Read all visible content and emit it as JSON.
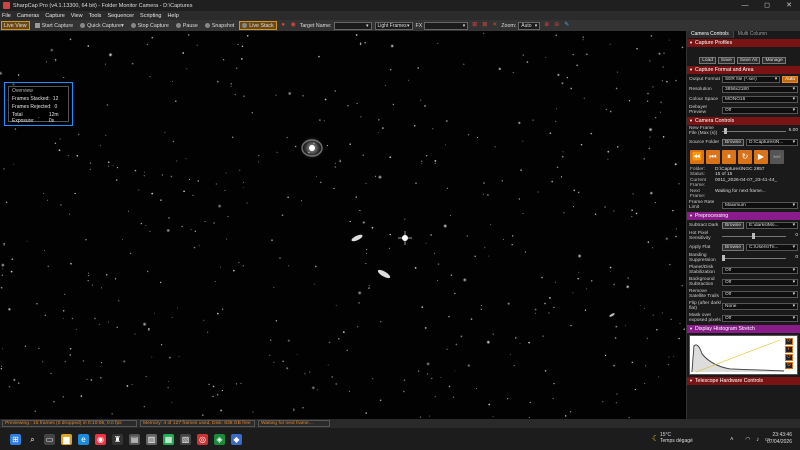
{
  "window": {
    "title": "SharpCap Pro (v4.1.13300, 64 bit) - Folder Monitor Camera - D:\\Captures",
    "minimize": "—",
    "maximize": "◻",
    "close": "✕"
  },
  "menu": [
    "File",
    "Cameras",
    "Capture",
    "View",
    "Tools",
    "Sequencer",
    "Scripting",
    "Help"
  ],
  "toolbar": {
    "live_view": "Live View",
    "start_capture": "Start Capture",
    "quick_capture": "Quick Capture",
    "stop_capture": "Stop Capture",
    "pause": "Pause",
    "snapshot": "Snapshot",
    "live_stack": "Live Stack",
    "target_name_label": "Target Name:",
    "frame_type": "Light Frames",
    "fx_label": "FX",
    "zoom_label": "Zoom:",
    "zoom_value": "Auto"
  },
  "overview": {
    "title": "Overview",
    "frames_stacked_label": "Frames Stacked:",
    "frames_stacked": "12",
    "frames_rejected_label": "Frames Rejected:",
    "frames_rejected": "0",
    "total_exposure_label": "Total Exposure:",
    "total_exposure": "12m 0s"
  },
  "panel": {
    "tab_camera": "Camera Controls",
    "tab_multi": "Multi Column",
    "capture_profiles": {
      "title": "Capture Profiles",
      "load": "Load",
      "save": "Save",
      "save_as": "Save As",
      "manage": "Manage"
    },
    "capture_format": {
      "title": "Capture Format and Area",
      "output_format_label": "Output Format",
      "output_format": "SER file (*.ser)",
      "auto": "Auto",
      "resolution_label": "Resolution",
      "resolution": "3856x2180",
      "colour_space_label": "Colour Space",
      "colour_space": "MONO16",
      "debayer_label": "Debayer Preview",
      "debayer": "Off"
    },
    "camera_controls": {
      "title": "Camera Controls",
      "new_frame_label": "New Frame File (Max (s))",
      "new_frame_value": "5.00",
      "source_folder_label": "Source Folder",
      "browse": "Browse",
      "source_folder": "D:\\Captures\\N...",
      "folder_label": "Folder:",
      "folder": "D:\\Captures\\NGC 2857",
      "status_label": "Status:",
      "status": "15 of 15",
      "current_frame_label": "Current Frame:",
      "current_frame": "0011_2026-04-07_23-41-44_",
      "next_frame_label": "Next Frame:",
      "next_frame": "Waiting for next frame...",
      "frame_rate_label": "Frame Rate Limit",
      "frame_rate": "Maximum"
    },
    "preprocessing": {
      "title": "Preprocessing",
      "subtract_dark_label": "Subtract Dark",
      "subtract_dark": "E:\\darks\\Mo...",
      "hot_pixel_label": "Hot Pixel Sensitivity",
      "hot_pixel": "0",
      "apply_flat_label": "Apply Flat",
      "apply_flat": "C:\\Users\\Tri...",
      "banding_label": "Banding Suppression",
      "banding": "0",
      "planet_label": "Planet/Disk Stabilization",
      "planet": "Off",
      "background_label": "Background Subtraction",
      "background": "Off",
      "remove_label": "Remove Satellite Trails",
      "remove": "Off",
      "flip_label": "Flip (after dark/ flat)",
      "flip": "None",
      "mask_label": "Mask over exposed pixels",
      "mask": "Off"
    },
    "histogram": {
      "title": "Display Histogram Stretch"
    },
    "telescope": {
      "title": "Telescope Hardware Controls"
    }
  },
  "status_bar": {
    "previewing": "Previewing : 15 frames (0 dropped) in 0:10:06, 0.0 fps",
    "memory": "Memory: 4 of 127 frames used, Disk: 838 GB free",
    "waiting": "Waiting for next frame..."
  },
  "taskbar": {
    "weather_temp": "15°C",
    "weather_desc": "Temps dégagé",
    "time": "23:43:46",
    "date": "07/04/2026"
  },
  "colors": {
    "accent": "#d9731a",
    "section_red": "#7a1414",
    "section_purple": "#8a1b8a",
    "highlight_blue": "#1e90ff"
  }
}
